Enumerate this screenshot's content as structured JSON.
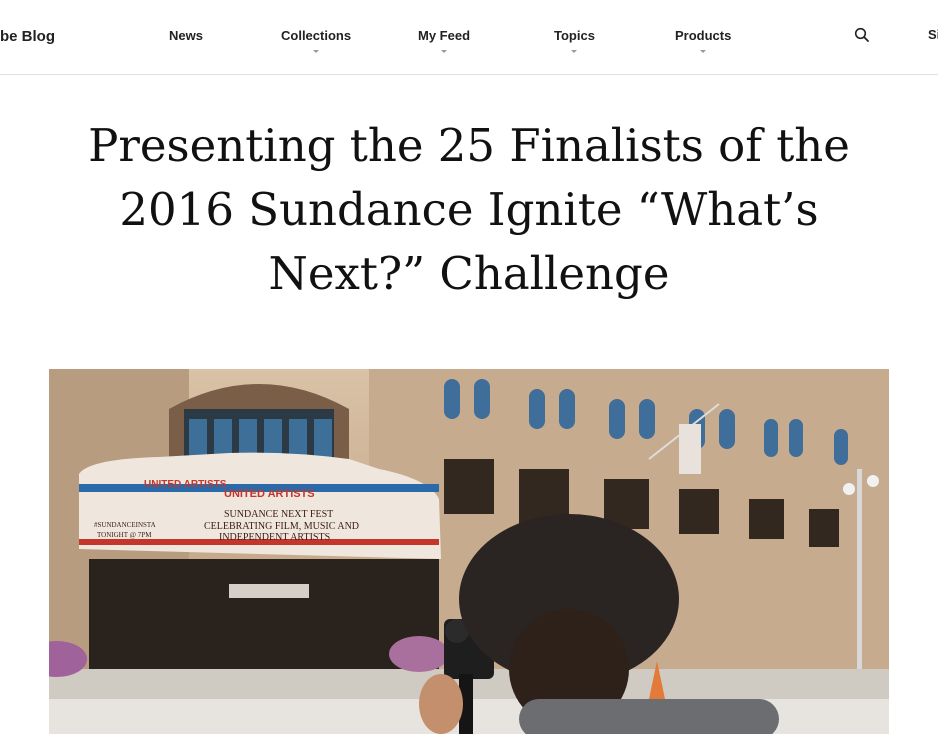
{
  "header": {
    "brand": "be Blog",
    "nav": [
      {
        "label": "News",
        "has_menu": false
      },
      {
        "label": "Collections",
        "has_menu": true
      },
      {
        "label": "My Feed",
        "has_menu": true
      },
      {
        "label": "Topics",
        "has_menu": true
      },
      {
        "label": "Products",
        "has_menu": true
      }
    ],
    "search_icon": "search-icon",
    "signin_label": "Si"
  },
  "article": {
    "title": "Presenting the 25 Finalists of the 2016 Sundance Ignite “What’s Next?” Challenge",
    "hero_image": {
      "marquee_brand": "UNITED ARTISTS",
      "marquee_line1": "SUNDANCE NEXT FEST",
      "marquee_line2": "CELEBRATING FILM, MUSIC AND",
      "marquee_line3": "INDEPENDENT ARTISTS",
      "marquee_left1": "#SUNDANCEINSTA",
      "marquee_left2": "TONIGHT @ 7PM"
    }
  },
  "colors": {
    "text": "#222222",
    "marquee_red": "#c4362c",
    "marquee_blue": "#2a6aa8",
    "building": "#c9ad90"
  }
}
